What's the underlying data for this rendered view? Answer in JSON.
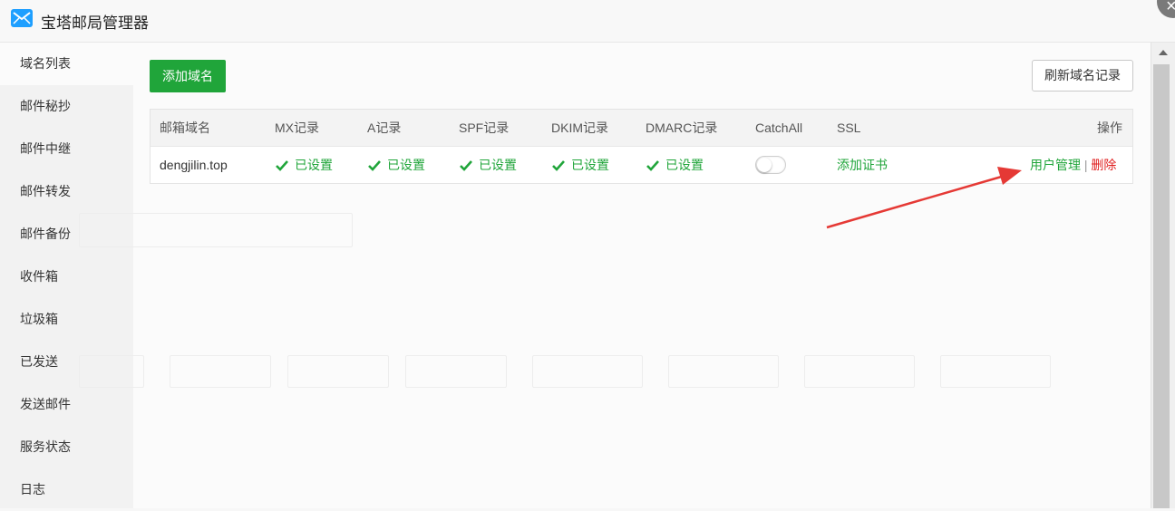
{
  "window": {
    "title": "宝塔邮局管理器",
    "close_symbol": "×"
  },
  "sidebar": {
    "items": [
      {
        "label": "域名列表"
      },
      {
        "label": "邮件秘抄"
      },
      {
        "label": "邮件中继"
      },
      {
        "label": "邮件转发"
      },
      {
        "label": "邮件备份"
      },
      {
        "label": "收件箱"
      },
      {
        "label": "垃圾箱"
      },
      {
        "label": "已发送"
      },
      {
        "label": "发送邮件"
      },
      {
        "label": "服务状态"
      },
      {
        "label": "日志"
      }
    ]
  },
  "toolbar": {
    "add_label": "添加域名",
    "refresh_label": "刷新域名记录"
  },
  "table": {
    "headers": {
      "domain": "邮箱域名",
      "mx": "MX记录",
      "a": "A记录",
      "spf": "SPF记录",
      "dkim": "DKIM记录",
      "dmarc": "DMARC记录",
      "catchall": "CatchAll",
      "ssl": "SSL",
      "ops": "操作"
    },
    "rows": [
      {
        "domain": "dengjilin.top",
        "mx": "已设置",
        "a": "已设置",
        "spf": "已设置",
        "dkim": "已设置",
        "dmarc": "已设置",
        "catchall_enabled": false,
        "ssl": "添加证书",
        "user_manage": "用户管理",
        "separator": "|",
        "delete": "删除"
      }
    ]
  },
  "colors": {
    "accent_green": "#20a53a",
    "danger_red": "#e02020",
    "arrow_red": "#e53935"
  },
  "icons": {
    "app": "mail-icon",
    "status": "check-icon",
    "close": "close-icon"
  }
}
